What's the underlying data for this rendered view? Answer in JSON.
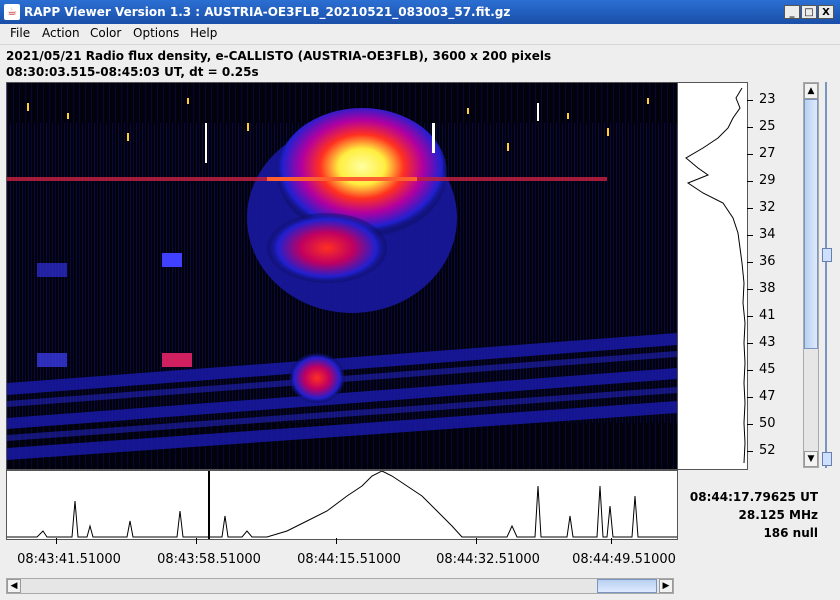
{
  "window": {
    "title": "RAPP Viewer Version 1.3 : AUSTRIA-OE3FLB_20210521_083003_57.fit.gz",
    "minimize": "_",
    "maximize": "□",
    "close": "X"
  },
  "menu": {
    "items": [
      "File",
      "Action",
      "Color",
      "Options",
      "Help"
    ]
  },
  "info": {
    "line1": "2021/05/21  Radio flux density, e-CALLISTO (AUSTRIA-OE3FLB),  3600 x 200 pixels",
    "line2": "08:30:03.515-08:45:03 UT,  dt = 0.25s"
  },
  "freq_axis": {
    "labels": [
      "23",
      "25",
      "27",
      "29",
      "32",
      "34",
      "36",
      "38",
      "41",
      "43",
      "45",
      "47",
      "50",
      "52"
    ]
  },
  "time_axis": {
    "labels": [
      "08:43:41.51000",
      "08:43:58.51000",
      "08:44:15.51000",
      "08:44:32.51000",
      "08:44:49.51000"
    ]
  },
  "readout": {
    "time": "08:44:17.79625 UT",
    "freq": "28.125 MHz",
    "value": "186 null"
  },
  "colors": {
    "title_bar": "#1a4fa8",
    "spectrogram_bg": "#000000",
    "scroll_thumb": "#b8d0f0"
  }
}
